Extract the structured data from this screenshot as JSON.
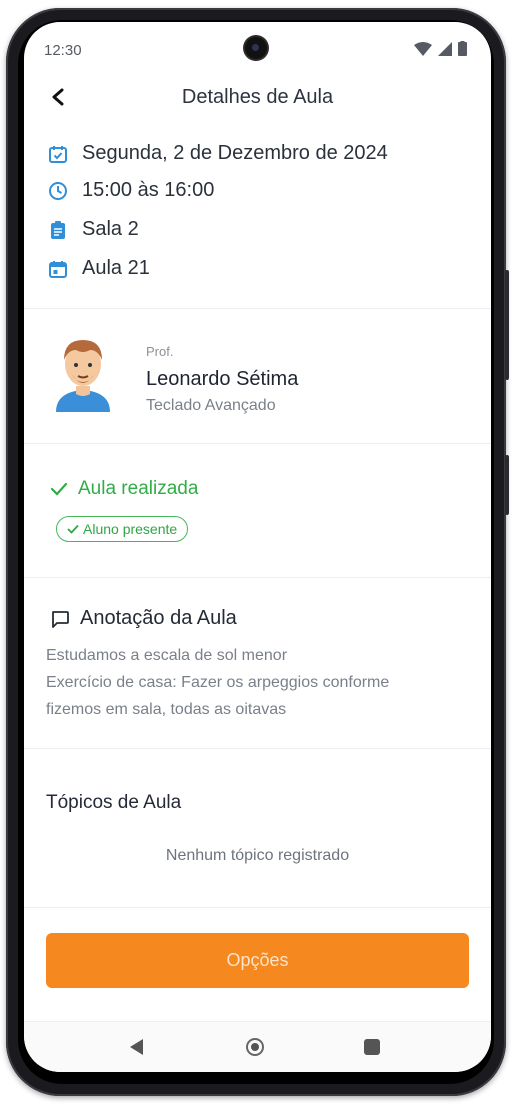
{
  "status_bar": {
    "time": "12:30"
  },
  "header": {
    "title": "Detalhes de Aula"
  },
  "lesson": {
    "date": "Segunda,  2 de Dezembro de 2024",
    "time": "15:00 às 16:00",
    "room": "Sala 2",
    "lesson_number": "Aula 21"
  },
  "teacher": {
    "label": "Prof.",
    "name": "Leonardo Sétima",
    "course": "Teclado Avançado"
  },
  "attendance": {
    "status": "Aula realizada",
    "badge": "Aluno presente"
  },
  "notes": {
    "title": "Anotação da Aula",
    "lines": [
      "Estudamos a escala de sol menor",
      "Exercício de casa: Fazer os arpeggios conforme",
      "fizemos em sala, todas as oitavas"
    ]
  },
  "topics": {
    "title": "Tópicos de Aula",
    "empty": "Nenhum tópico registrado"
  },
  "actions": {
    "options_label": "Opções"
  },
  "colors": {
    "accent_blue": "#2f8fd8",
    "success_green": "#2fae46",
    "primary_orange": "#f5881f"
  }
}
